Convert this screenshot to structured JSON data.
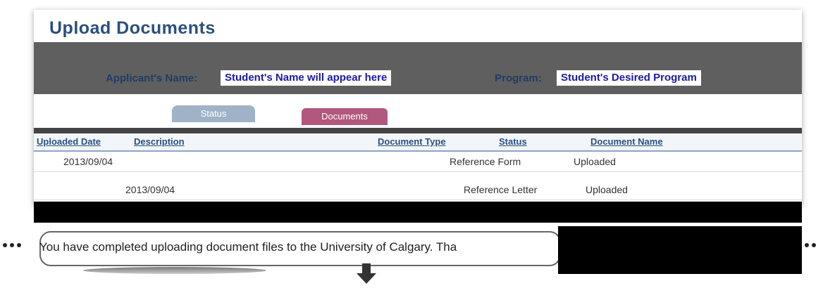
{
  "page": {
    "title": "Upload Documents"
  },
  "header": {
    "applicant_label": "Applicant's Name:",
    "applicant_value": "Student's Name will appear here",
    "program_label": "Program:",
    "program_value": "Student's Desired Program"
  },
  "tabs": [
    {
      "label": "Status"
    },
    {
      "label": "Documents"
    }
  ],
  "table": {
    "columns": [
      "Uploaded Date",
      "Description",
      "Document Type",
      "Status",
      "Document Name"
    ],
    "rows": [
      {
        "uploaded_date": "2013/09/04",
        "description": "",
        "document_type": "Reference Form",
        "status": "Uploaded",
        "document_name": ""
      },
      {
        "uploaded_date": "2013/09/04",
        "description": "",
        "document_type": "Reference Letter",
        "status": "Uploaded",
        "document_name": ""
      }
    ]
  },
  "message": {
    "text": "You have completed uploading document files to the University of Calgary. Tha"
  },
  "colors": {
    "accent_blue": "#2b4f80",
    "tab_active": "#b2577e",
    "tab_inactive": "#9fb2c7"
  },
  "icons": {
    "down_arrow": "down-arrow-icon"
  }
}
